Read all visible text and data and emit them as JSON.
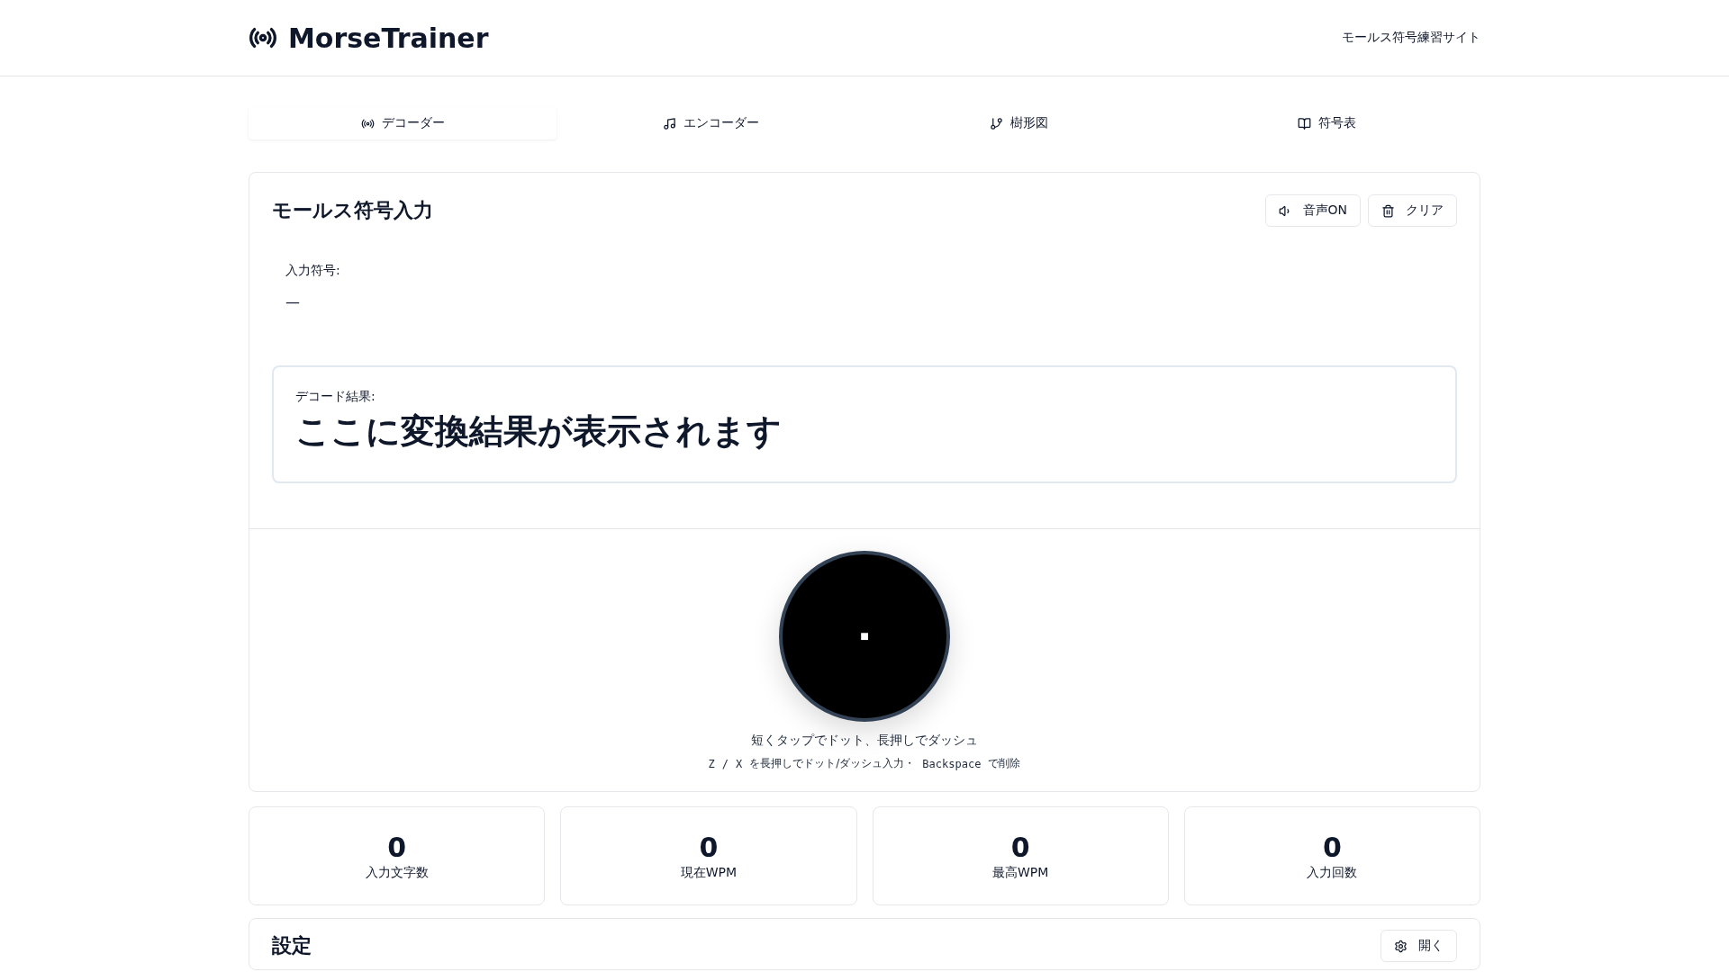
{
  "header": {
    "logo": "MorseTrainer",
    "tagline": "モールス符号練習サイト"
  },
  "tabs": [
    {
      "label": "デコーダー",
      "kind": "radio",
      "selected": true
    },
    {
      "label": "エンコーダー",
      "kind": "music",
      "selected": false
    },
    {
      "label": "樹形図",
      "kind": "branch",
      "selected": false
    },
    {
      "label": "符号表",
      "kind": "book",
      "selected": false
    }
  ],
  "input_card": {
    "title": "モールス符号入力",
    "buttons": [
      {
        "label": "音声ON",
        "kind": "sound"
      },
      {
        "label": "クリア",
        "kind": "trash"
      }
    ],
    "input_label": "入力符号:",
    "input_value": "—",
    "result_label": "デコード結果:",
    "result_text": "ここに変換結果が表示されます",
    "key_symbol": "■",
    "hint": "短くタップでドット、長押しでダッシュ",
    "shortcut_hint": [
      {
        "kind": "key",
        "text": "Z"
      },
      {
        "kind": "key",
        "text": "/"
      },
      {
        "kind": "key",
        "text": "X"
      },
      {
        "kind": "text",
        "text": "を長押しでドット/ダッシュ入力・"
      },
      {
        "kind": "key",
        "text": "Backspace"
      },
      {
        "kind": "text",
        "text": "で削除"
      }
    ]
  },
  "stats": [
    {
      "value": "0",
      "label": "入力文字数"
    },
    {
      "value": "0",
      "label": "現在WPM"
    },
    {
      "value": "0",
      "label": "最高WPM"
    },
    {
      "value": "0",
      "label": "入力回数"
    }
  ],
  "settings": {
    "title": "設定",
    "button": "開く"
  }
}
